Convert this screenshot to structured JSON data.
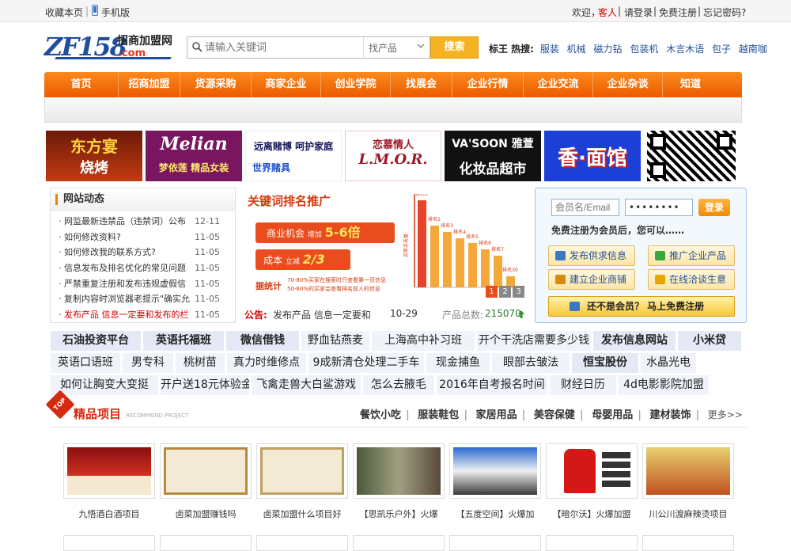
{
  "topbar": {
    "bookmark": "收藏本页",
    "mobile": "手机版",
    "welcome": "欢迎，",
    "guest": "客人",
    "login": "请登录",
    "register": "免费注册",
    "forgot": "忘记密码?"
  },
  "logo": {
    "main": "ZF158",
    "sub": ".com",
    "tag": "招商加盟网"
  },
  "search": {
    "placeholder": "请输入关键词",
    "scope": "找产品",
    "button": "搜索"
  },
  "hot": {
    "label": "标王 热搜:",
    "items": [
      "服装",
      "机械",
      "磁力钻",
      "包装机",
      "木言木语",
      "包子",
      "越南咖"
    ]
  },
  "nav": [
    "首页",
    "招商加盟",
    "货源采购",
    "商家企业",
    "创业学院",
    "找展会",
    "企业行情",
    "企业交流",
    "企业杂谈",
    "知道"
  ],
  "banners": [
    {
      "text": "东方宴",
      "sub": "烧烤"
    },
    {
      "text": "Melian",
      "sub": "梦依莲 精品女装"
    },
    {
      "text": "远离赌博 呵护家庭",
      "sub": "世界赌具"
    },
    {
      "text": "恋慕情人",
      "sub": "L.M.O.R."
    },
    {
      "text": "VA'SOON 雅萱",
      "sub": "化妆品超市"
    },
    {
      "text": "香·面馆",
      "sub": ""
    },
    {
      "text": "",
      "sub": ""
    }
  ],
  "news": {
    "title": "网站动态",
    "items": [
      {
        "t": "· 网监最新违禁品（违禁词）公布",
        "d": "12-11"
      },
      {
        "t": "· 如何修改资料?",
        "d": "11-05"
      },
      {
        "t": "· 如何修改我的联系方式?",
        "d": "11-05"
      },
      {
        "t": "· 信息发布及排名优化的常见问题",
        "d": "11-05"
      },
      {
        "t": "· 严禁重复注册和发布违规虚假信",
        "d": "11-05"
      },
      {
        "t": "· 复制内容时浏览器老提示\"确实允",
        "d": "11-05"
      },
      {
        "t": "· 发布产品 信息一定要和发布的栏",
        "d": "11-05"
      }
    ]
  },
  "promo": {
    "title": "关键词排名推广",
    "line1": "商业机会",
    "line1b": "增加",
    "line1c": "5-6倍",
    "line2": "成本",
    "line2b": "立减",
    "line2c": "2/3",
    "stat_label": "据统计",
    "stat1": "70-80%买家在搜索时只查看第一页信息",
    "stat2": "50-60%的买家会查看排名前人的信息",
    "ranks": [
      "排名1",
      "排名2",
      "排名3",
      "排名4",
      "排名5",
      "排名6",
      "排名7",
      "排名30"
    ],
    "axis": "买家点击量",
    "pages": [
      "1",
      "2",
      "3"
    ]
  },
  "notice": {
    "label": "公告:",
    "text": "发布产品 信息一定要和",
    "date": "10-29",
    "count_label": "产品总数:",
    "count": "215070"
  },
  "login": {
    "user_placeholder": "会员名/Email",
    "pass_value": "••••••••",
    "submit": "登录",
    "tip": "免费注册为会员后，您可以……",
    "actions": [
      "发布供求信息",
      "推广企业产品",
      "建立企业商铺",
      "在线洽谈生意"
    ],
    "register": "还不是会员？ 马上免费注册"
  },
  "keywords": [
    [
      "石油投资平台",
      "英语托福班",
      "微信借钱",
      "野血钻燕麦",
      "上海高中补习班",
      "开个干洗店需要多少钱",
      "发布信息网站",
      "小米贷"
    ],
    [
      "英语口语班",
      "男专科",
      "桃树苗",
      "真力时维修点",
      "9成新清仓处理二手车",
      "现金捕鱼",
      "眼部去皱法",
      "恒宝股份",
      "水晶光电"
    ],
    [
      "如何让胸变大变挺",
      "开户送18元体验金",
      "飞禽走兽大白鲨游戏",
      "怎么去腋毛",
      "2016年自考报名时间",
      "财经日历",
      "4d电影影院加盟"
    ]
  ],
  "products": {
    "title": "精品项目",
    "subtitle": "RECOMMEND PROJECT",
    "badge": "TOP",
    "categories": [
      "餐饮小吃",
      "服装鞋包",
      "家居用品",
      "美容保健",
      "母婴用品",
      "建材装饰"
    ],
    "more": "更多>>",
    "items": [
      {
        "caption": "九悟酒白酒项目"
      },
      {
        "caption": "卤菜加盟赚钱吗"
      },
      {
        "caption": "卤菜加盟什么项目好"
      },
      {
        "caption": "【思凯乐户外】火爆"
      },
      {
        "caption": "【五度空间】火爆加"
      },
      {
        "caption": "【暗尔沃】火爆加盟"
      },
      {
        "caption": "川公川渡麻辣烫项目"
      }
    ]
  }
}
